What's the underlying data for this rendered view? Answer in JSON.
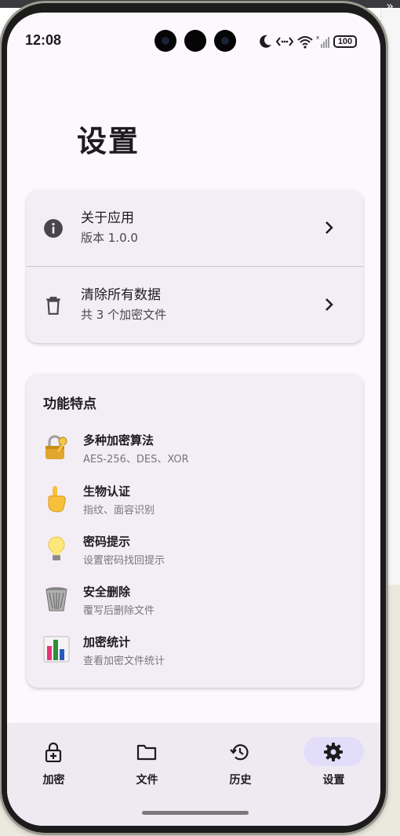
{
  "status_bar": {
    "time": "12:08",
    "battery": "100"
  },
  "page": {
    "title": "设置"
  },
  "settings": [
    {
      "title": "关于应用",
      "subtitle": "版本 1.0.0"
    },
    {
      "title": "清除所有数据",
      "subtitle": "共 3 个加密文件"
    }
  ],
  "features": {
    "title": "功能特点",
    "items": [
      {
        "name": "多种加密算法",
        "desc": "AES-256、DES、XOR",
        "icon": "lock-with-key-icon"
      },
      {
        "name": "生物认证",
        "desc": "指纹、面容识别",
        "icon": "pointing-finger-icon"
      },
      {
        "name": "密码提示",
        "desc": "设置密码找回提示",
        "icon": "light-bulb-icon"
      },
      {
        "name": "安全删除",
        "desc": "覆写后删除文件",
        "icon": "trash-bin-icon"
      },
      {
        "name": "加密统计",
        "desc": "查看加密文件统计",
        "icon": "bar-chart-icon"
      }
    ]
  },
  "nav": [
    {
      "label": "加密",
      "icon": "lock-plus-icon"
    },
    {
      "label": "文件",
      "icon": "folder-icon"
    },
    {
      "label": "历史",
      "icon": "history-icon"
    },
    {
      "label": "设置",
      "icon": "gear-icon",
      "active": true
    }
  ],
  "colors": {
    "background": "#fcf8fe",
    "card": "#f3edf5",
    "nav_active": "#e2defa",
    "text": "#1d1b20"
  }
}
